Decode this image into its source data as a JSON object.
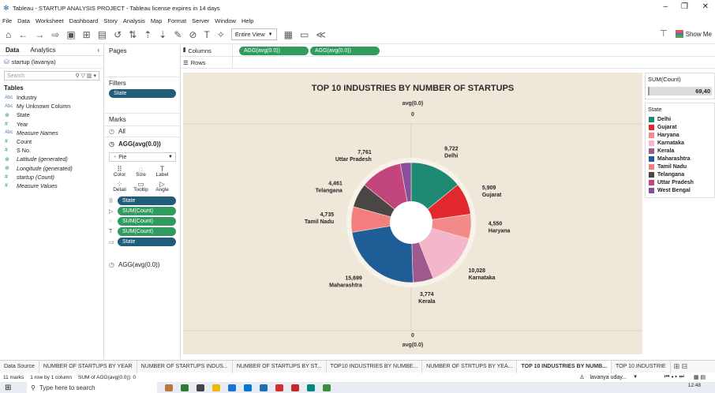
{
  "window": {
    "title": "Tableau - STARTUP ANALYSIS PROJECT - Tableau license expires in 14 days",
    "controls": [
      "–",
      "❐",
      "✕"
    ]
  },
  "menu": [
    "File",
    "Data",
    "Worksheet",
    "Dashboard",
    "Story",
    "Analysis",
    "Map",
    "Format",
    "Server",
    "Window",
    "Help"
  ],
  "toolbar": {
    "fit_value": "Entire View",
    "show_me_label": "Show Me"
  },
  "data_pane": {
    "tabs": [
      "Data",
      "Analytics"
    ],
    "datasource": "startup (lavanya)",
    "search_placeholder": "Search",
    "tables_header": "Tables",
    "fields": [
      {
        "type": "Abc",
        "name": "Industry",
        "italic": false
      },
      {
        "type": "Abc",
        "name": "My Unknown Column",
        "italic": false
      },
      {
        "type": "⊕",
        "name": "State",
        "italic": false
      },
      {
        "type": "#",
        "name": "Year",
        "italic": false
      },
      {
        "type": "Abc",
        "name": "Measure Names",
        "italic": true
      },
      {
        "type": "#",
        "name": "Count",
        "italic": false
      },
      {
        "type": "#",
        "name": "S No.",
        "italic": false
      },
      {
        "type": "⊕",
        "name": "Latitude (generated)",
        "italic": true
      },
      {
        "type": "⊕",
        "name": "Longitude (generated)",
        "italic": true
      },
      {
        "type": "#",
        "name": "startup (Count)",
        "italic": true
      },
      {
        "type": "#",
        "name": "Measure Values",
        "italic": true
      }
    ]
  },
  "cards": {
    "pages_label": "Pages",
    "filters_label": "Filters",
    "filter_pill": "State",
    "marks_label": "Marks",
    "marks_all": "All",
    "marks_agg": "AGG(avg(0.0))",
    "mark_type": "Pie",
    "mark_buttons": [
      {
        "glyph": "⠿",
        "label": "Color"
      },
      {
        "glyph": "◌",
        "label": "Size"
      },
      {
        "glyph": "T",
        "label": "Label"
      },
      {
        "glyph": "⁘",
        "label": "Detail"
      },
      {
        "glyph": "▭",
        "label": "Tooltip"
      },
      {
        "glyph": "▷",
        "label": "Angle"
      }
    ],
    "encodings": [
      {
        "glyph": "⠿",
        "label": "State",
        "color": "blue"
      },
      {
        "glyph": "▷",
        "label": "SUM(Count)",
        "color": "green"
      },
      {
        "glyph": "◌",
        "label": "SUM(Count)",
        "color": "green"
      },
      {
        "glyph": "T",
        "label": "SUM(Count)",
        "color": "green"
      },
      {
        "glyph": "▭",
        "label": "State",
        "color": "blue"
      }
    ],
    "marks_agg2": "AGG(avg(0.0))"
  },
  "shelves": {
    "columns_label": "Columns",
    "rows_label": "Rows",
    "column_pills": [
      "AGG(avg(0.0))",
      "AGG(avg(0.0))"
    ]
  },
  "view": {
    "title": "TOP 10 INDUSTRIES BY NUMBER OF STARTUPS",
    "top_axis_title": "avg(0.0)",
    "top_axis_tick": "0",
    "bottom_axis_tick": "0",
    "bottom_axis_title": "avg(0.0)"
  },
  "chart_data": {
    "type": "pie",
    "title": "TOP 10 INDUSTRIES BY NUMBER OF STARTUPS",
    "donut": true,
    "slices": [
      {
        "label": "Delhi",
        "value": 9722,
        "display": "9,722",
        "color": "#1f8a74"
      },
      {
        "label": "Gujarat",
        "value": 5909,
        "display": "5,909",
        "color": "#e0282e"
      },
      {
        "label": "Haryana",
        "value": 4550,
        "display": "4,550",
        "color": "#f28a8a"
      },
      {
        "label": "Karnataka",
        "value": 10028,
        "display": "10,028",
        "color": "#f4b6cb"
      },
      {
        "label": "Kerala",
        "value": 3774,
        "display": "3,774",
        "color": "#9e5a8f"
      },
      {
        "label": "Maharashtra",
        "value": 15699,
        "display": "15,699",
        "color": "#1f5d96"
      },
      {
        "label": "Tamil Nadu",
        "value": 4735,
        "display": "4,735",
        "color": "#f47d7d"
      },
      {
        "label": "Telangana",
        "value": 4461,
        "display": "4,461",
        "color": "#4a4643"
      },
      {
        "label": "Uttar Pradesh",
        "value": 7761,
        "display": "7,761",
        "color": "#c2457b"
      },
      {
        "label": "West Bengal",
        "value": 2000,
        "display": "",
        "color": "#8a4f9c"
      }
    ]
  },
  "legends": {
    "sum_header": "SUM(Count)",
    "sum_value": "69,40",
    "state_header": "State",
    "items": [
      {
        "label": "Delhi",
        "color": "#1f8a74"
      },
      {
        "label": "Gujarat",
        "color": "#e0282e"
      },
      {
        "label": "Haryana",
        "color": "#f28a8a"
      },
      {
        "label": "Karnataka",
        "color": "#f4b6cb"
      },
      {
        "label": "Kerala",
        "color": "#9e5a8f"
      },
      {
        "label": "Maharashtra",
        "color": "#1f5d96"
      },
      {
        "label": "Tamil Nadu",
        "color": "#f47d7d"
      },
      {
        "label": "Telangana",
        "color": "#4a4643"
      },
      {
        "label": "Uttar Pradesh",
        "color": "#c2457b"
      },
      {
        "label": "West Bengal",
        "color": "#8a4f9c"
      }
    ]
  },
  "sheet_tabs": [
    {
      "label": "Data Source",
      "active": false
    },
    {
      "label": "NUMBER OF STARTUPS BY YEAR",
      "active": false
    },
    {
      "label": "NUMBER OF STARTUPS INDUS...",
      "active": false
    },
    {
      "label": "NUMBER OF STARTUPS BY ST...",
      "active": false
    },
    {
      "label": "TOP10 INDUSTRIES BY NUMBE...",
      "active": false
    },
    {
      "label": "NUMBER OF STRTUPS BY YEA...",
      "active": false
    },
    {
      "label": "TOP 10 INDUSTRIES BY NUMB...",
      "active": true
    },
    {
      "label": "TOP 10 INDUSTRIE",
      "active": false
    }
  ],
  "status": {
    "marks": "11 marks",
    "rows": "1 row by 1 column",
    "sum": "SUM of AGG(avg(0.0)): 0",
    "user": "lavanya uday..."
  },
  "taskbar": {
    "search_placeholder": "Type here to search",
    "time": "12:48"
  }
}
